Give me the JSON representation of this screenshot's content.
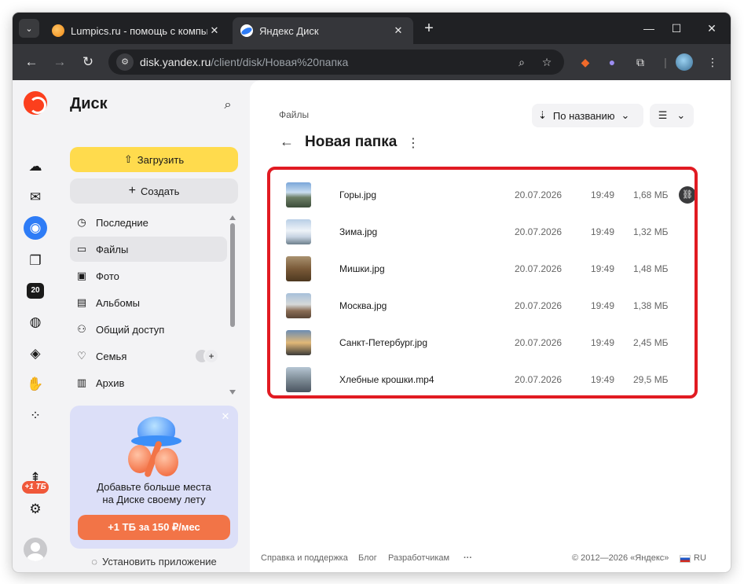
{
  "browser": {
    "tabs": [
      {
        "title": "Lumpics.ru - помощь с компьк",
        "active": false
      },
      {
        "title": "Яндекс Диск",
        "active": true
      }
    ],
    "url_host": "disk.yandex.ru",
    "url_path": "/client/disk/Новая%20папка"
  },
  "rail": {
    "storage_badge": "20",
    "tb_badge": "+1 ТБ"
  },
  "sidebar": {
    "title": "Диск",
    "upload_label": "Загрузить",
    "create_label": "Создать",
    "items": [
      {
        "label": "Последние",
        "icon": "clock-icon",
        "active": false
      },
      {
        "label": "Файлы",
        "icon": "folder-icon",
        "active": true
      },
      {
        "label": "Фото",
        "icon": "photo-icon",
        "active": false
      },
      {
        "label": "Альбомы",
        "icon": "albums-icon",
        "active": false
      },
      {
        "label": "Общий доступ",
        "icon": "shared-icon",
        "active": false
      },
      {
        "label": "Семья",
        "icon": "family-icon",
        "active": false
      },
      {
        "label": "Архив",
        "icon": "archive-icon",
        "active": false
      }
    ],
    "promo": {
      "text_line1": "Добавьте больше места",
      "text_line2": "на Диске своему лету",
      "button_label": "+1 ТБ за 150 ₽/мес"
    },
    "install_app": "Установить приложение"
  },
  "main": {
    "breadcrumb": "Файлы",
    "sort_label": "По названию",
    "folder_title": "Новая папка",
    "files": [
      {
        "name": "Горы.jpg",
        "date": "20.07.2026",
        "time": "19:49",
        "size": "1,68 МБ",
        "shared": true
      },
      {
        "name": "Зима.jpg",
        "date": "20.07.2026",
        "time": "19:49",
        "size": "1,32 МБ",
        "shared": false
      },
      {
        "name": "Мишки.jpg",
        "date": "20.07.2026",
        "time": "19:49",
        "size": "1,48 МБ",
        "shared": false
      },
      {
        "name": "Москва.jpg",
        "date": "20.07.2026",
        "time": "19:49",
        "size": "1,38 МБ",
        "shared": false
      },
      {
        "name": "Санкт-Петербург.jpg",
        "date": "20.07.2026",
        "time": "19:49",
        "size": "2,45 МБ",
        "shared": false
      },
      {
        "name": "Хлебные крошки.mp4",
        "date": "20.07.2026",
        "time": "19:49",
        "size": "29,5 МБ",
        "shared": false
      }
    ]
  },
  "footer": {
    "help": "Справка и поддержка",
    "blog": "Блог",
    "developers": "Разработчикам",
    "more": "···",
    "copyright": "© 2012—2026 «Яндекс»",
    "lang": "RU"
  },
  "colors": {
    "accent_yellow": "#ffdb4d",
    "accent_blue": "#2e7cf6",
    "promo_orange": "#f27447",
    "highlight_red": "#e11b22"
  }
}
